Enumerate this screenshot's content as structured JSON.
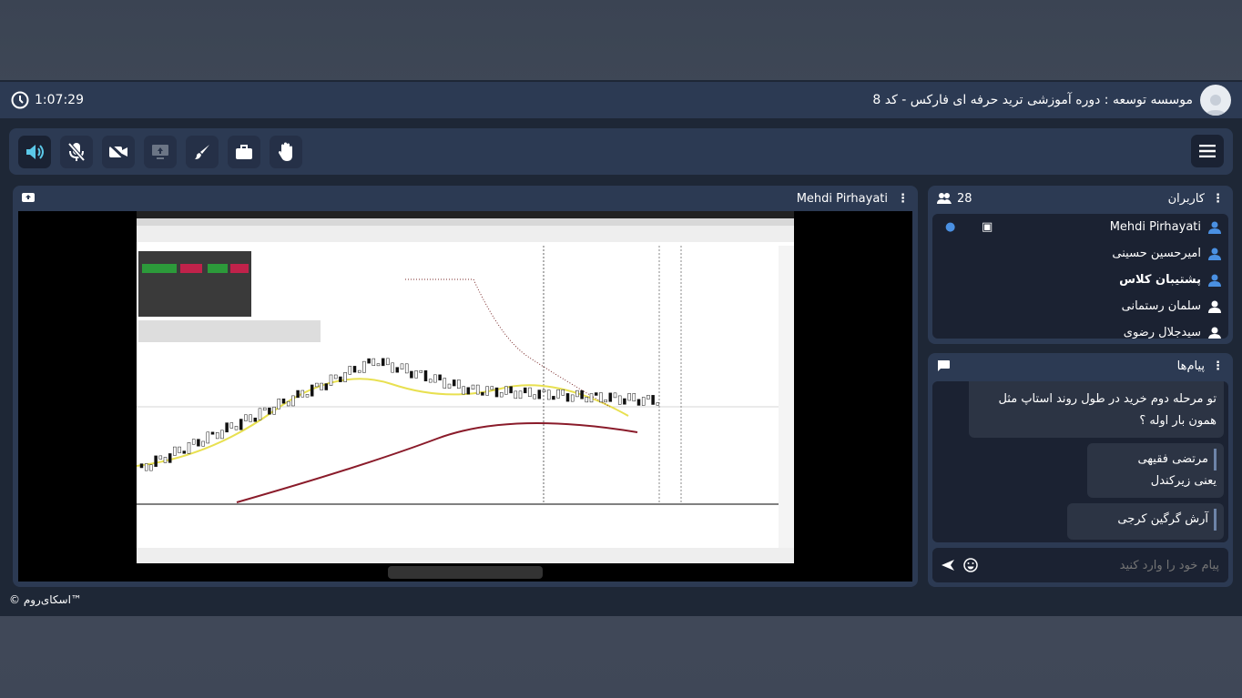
{
  "header": {
    "timer": "1:07:29",
    "title": "موسسه توسعه : دوره آموزشی ترید حرفه ای فارکس - کد 8"
  },
  "video": {
    "presenter": "Mehdi Pirhayati"
  },
  "users": {
    "title": "کاربران",
    "count": "28",
    "list": [
      {
        "name": "Mehdi Pirhayati",
        "color": "#4a90e2"
      },
      {
        "name": "امیرحسین حسینی",
        "color": "#4a90e2"
      },
      {
        "name": "پشتیبان کلاس",
        "color": "#4a90e2"
      },
      {
        "name": "سلمان رستمانی",
        "color": "#ffffff"
      },
      {
        "name": "سیدجلال رضوی",
        "color": "#ffffff"
      }
    ]
  },
  "messages": {
    "title": "پیام‌ها",
    "items": [
      {
        "sender": "",
        "text": "تو مرحله دوم خرید در طول روند استاپ مثل همون بار اوله ؟"
      },
      {
        "sender": "مرتضی فقیهی",
        "text": "یعنی زیرکندل"
      },
      {
        "sender": "آرش گرگین کرجی",
        "text": ""
      }
    ],
    "placeholder": "پیام خود را وارد کنید"
  },
  "footer": {
    "brand": "© اسکای‌روم™"
  },
  "colors": {
    "accent": "#5bc8e8",
    "user_blue": "#4a90e2"
  }
}
